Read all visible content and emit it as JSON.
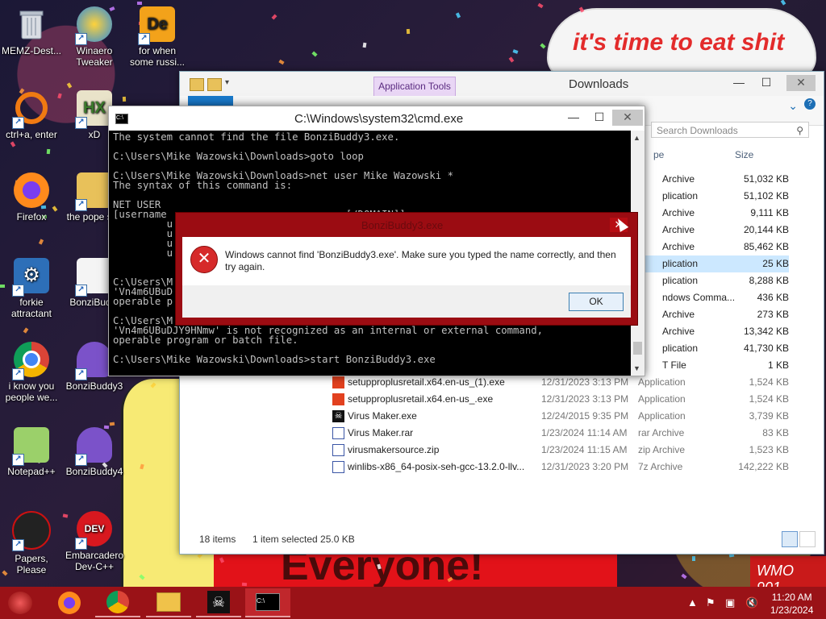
{
  "wallpaper": {
    "bubble_text": "it's time to eat shit",
    "banner_text": "Everyone!",
    "sign_text": "WMO 901"
  },
  "desktop": {
    "icons": [
      {
        "label": "MEMZ-Dest...",
        "icon": "recycle-bin-icon"
      },
      {
        "label": "Winaero Tweaker",
        "icon": "winaero-icon"
      },
      {
        "label": "for when some russi...",
        "icon": "de-app-icon"
      },
      {
        "label": "ctrl+a, enter",
        "icon": "orange-ring-icon"
      },
      {
        "label": "xD",
        "icon": "hxd-icon"
      },
      {
        "label": "Firefox",
        "icon": "firefox-icon"
      },
      {
        "label": "the pope shit",
        "icon": "pope-icon"
      },
      {
        "label": "forkie attractant",
        "icon": "settings-icon"
      },
      {
        "label": "BonziBud...",
        "icon": "bonzi-icon"
      },
      {
        "label": "i know you people we...",
        "icon": "chrome-icon"
      },
      {
        "label": "BonziBuddy3",
        "icon": "bonzi-purple-icon"
      },
      {
        "label": "Notepad++",
        "icon": "notepadpp-icon"
      },
      {
        "label": "BonziBuddy4",
        "icon": "bonzi-purple-icon"
      },
      {
        "label": "Papers, Please",
        "icon": "papers-please-icon"
      },
      {
        "label": "Embarcadero Dev-C++",
        "icon": "devcpp-icon"
      }
    ]
  },
  "explorer": {
    "title": "Downloads",
    "app_tools": "Application Tools",
    "search_placeholder": "Search Downloads",
    "columns": {
      "type": "pe",
      "size": "Size"
    },
    "top_rows": [
      {
        "type": "Archive",
        "size": "51,032 KB"
      },
      {
        "type": "plication",
        "size": "51,102 KB"
      },
      {
        "type": "Archive",
        "size": "9,111 KB"
      },
      {
        "type": "Archive",
        "size": "20,144 KB"
      },
      {
        "type": "Archive",
        "size": "85,462 KB"
      },
      {
        "type": "plication",
        "size": "25 KB"
      },
      {
        "type": "plication",
        "size": "8,288 KB"
      },
      {
        "type": "ndows Comma...",
        "size": "436 KB"
      },
      {
        "type": "Archive",
        "size": "273 KB"
      },
      {
        "type": "Archive",
        "size": "13,342 KB"
      },
      {
        "type": "plication",
        "size": "41,730 KB"
      },
      {
        "type": "T File",
        "size": "1 KB"
      }
    ],
    "files": [
      {
        "name": "setupproplusretail.x64.en-us_(1).exe",
        "date": "12/31/2023 3:13 PM",
        "type": "Application",
        "size": "1,524 KB",
        "icon": "office-icon"
      },
      {
        "name": "setupproplusretail.x64.en-us_.exe",
        "date": "12/31/2023 3:13 PM",
        "type": "Application",
        "size": "1,524 KB",
        "icon": "office-icon"
      },
      {
        "name": "Virus Maker.exe",
        "date": "12/24/2015 9:35 PM",
        "type": "Application",
        "size": "3,739 KB",
        "icon": "pirate-icon"
      },
      {
        "name": "Virus Maker.rar",
        "date": "1/23/2024 11:14 AM",
        "type": "rar Archive",
        "size": "83 KB",
        "icon": "archive-icon"
      },
      {
        "name": "virusmakersource.zip",
        "date": "1/23/2024 11:15 AM",
        "type": "zip Archive",
        "size": "1,523 KB",
        "icon": "archive-icon"
      },
      {
        "name": "winlibs-x86_64-posix-seh-gcc-13.2.0-llv...",
        "date": "12/31/2023 3:20 PM",
        "type": "7z Archive",
        "size": "142,222 KB",
        "icon": "archive-icon"
      }
    ],
    "status_items": "18 items",
    "status_selected": "1 item selected  25.0 KB"
  },
  "cmd": {
    "title": "C:\\Windows\\system32\\cmd.exe",
    "lines": [
      "The system cannot find the file BonziBuddy3.exe.",
      "",
      "C:\\Users\\Mike Wazowski\\Downloads>goto loop",
      "",
      "C:\\Users\\Mike Wazowski\\Downloads>net user Mike Wazowski *",
      "The syntax of this command is:",
      "",
      "NET USER",
      "[username                              [/DOMAIN]]",
      "         u",
      "         u",
      "         u",
      "         u",
      "",
      "",
      "C:\\Users\\M",
      "'Vn4m6UBuD",
      "operable p",
      "",
      "C:\\Users\\M",
      "'Vn4m6UBuDJY9HNmw' is not recognized as an internal or external command,",
      "operable program or batch file.",
      "",
      "C:\\Users\\Mike Wazowski\\Downloads>start BonziBuddy3.exe"
    ]
  },
  "dialog": {
    "title": "BonziBuddy3.exe",
    "message": "Windows cannot find 'BonziBuddy3.exe'. Make sure you typed the name correctly, and then try again.",
    "ok_label": "OK"
  },
  "taskbar": {
    "items": [
      {
        "name": "firefox-icon"
      },
      {
        "name": "chrome-icon"
      },
      {
        "name": "file-explorer-icon"
      },
      {
        "name": "pirate-icon"
      },
      {
        "name": "cmd-icon"
      }
    ],
    "time": "11:20 AM",
    "date": "1/23/2024"
  }
}
